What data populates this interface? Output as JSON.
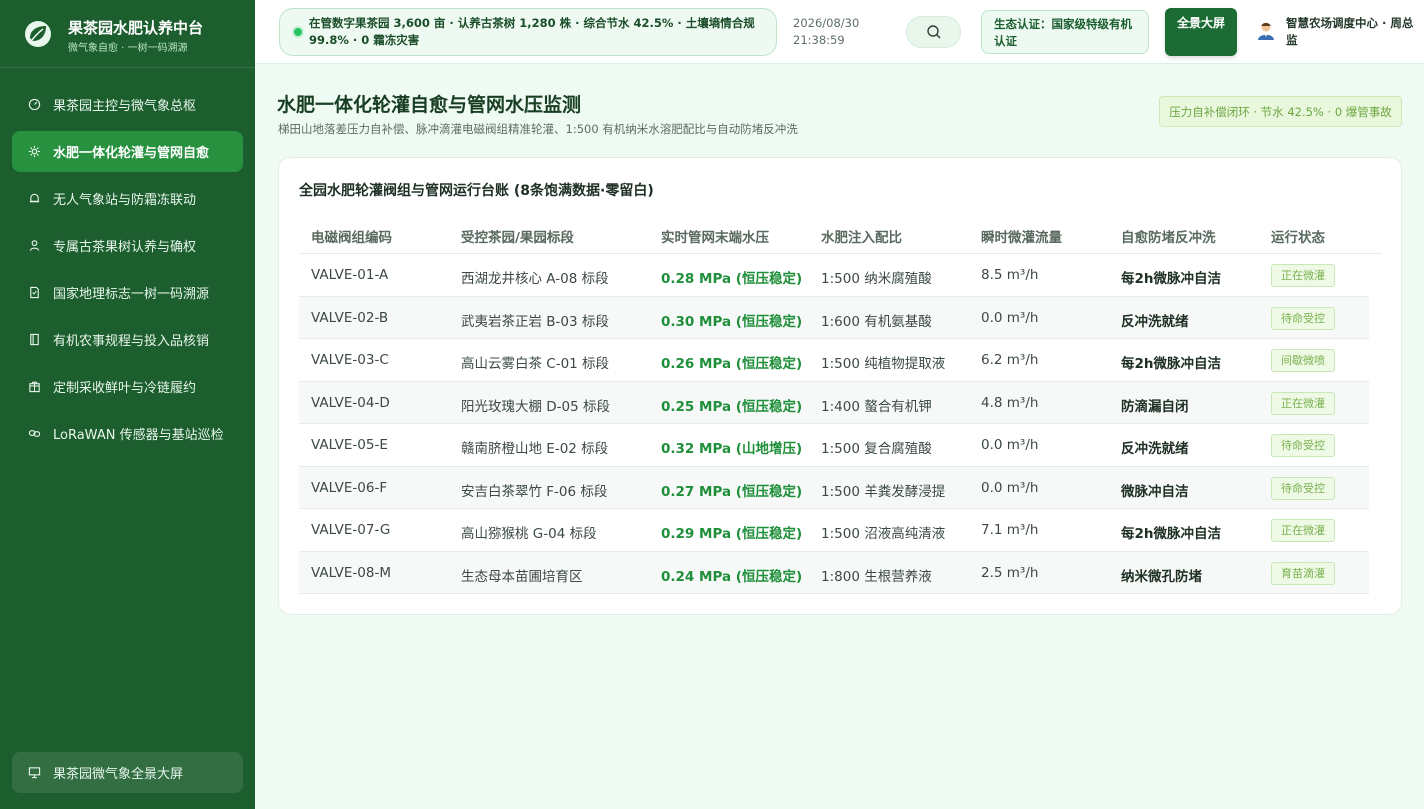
{
  "brand": {
    "title": "果茶园水肥认养中台",
    "subtitle": "微气象自愈 · 一树一码溯源",
    "logo_icon": "leaf-icon"
  },
  "sidebar": {
    "items": [
      {
        "label": "果茶园主控与微气象总枢",
        "icon": "dashboard-icon",
        "active": false
      },
      {
        "label": "水肥一体化轮灌与管网自愈",
        "icon": "gear-icon",
        "active": true
      },
      {
        "label": "无人气象站与防霜冻联动",
        "icon": "bell-icon",
        "active": false
      },
      {
        "label": "专属古茶果树认养与确权",
        "icon": "user-icon",
        "active": false
      },
      {
        "label": "国家地理标志一树一码溯源",
        "icon": "document-icon",
        "active": false
      },
      {
        "label": "有机农事规程与投入品核销",
        "icon": "book-icon",
        "active": false
      },
      {
        "label": "定制采收鲜叶与冷链履约",
        "icon": "package-icon",
        "active": false
      },
      {
        "label": "LoRaWAN 传感器与基站巡检",
        "icon": "link-icon",
        "active": false
      }
    ],
    "bottom": {
      "label": "果茶园微气象全景大屏",
      "icon": "monitor-icon"
    }
  },
  "header": {
    "ticker": "在管数字果茶园 3,600 亩 · 认养古茶树 1,280 株 · 综合节水 42.5% · 土壤墒情合规 99.8% · 0 霜冻灾害",
    "date": "2026/08/30",
    "time": "21:38:59",
    "search_icon": "search-icon",
    "cert": "生态认证：国家级特级有机认证",
    "bigscreen_label": "全景大屏",
    "user_name": "智慧农场调度中心 · 周总监"
  },
  "page": {
    "title": "水肥一体化轮灌自愈与管网水压监测",
    "subtitle": "梯田山地落差压力自补偿、脉冲滴灌电磁阀组精准轮灌、1:500 有机纳米水溶肥配比与自动防堵反冲洗",
    "status": "压力自补偿闭环 · 节水 42.5% · 0 爆管事故"
  },
  "table": {
    "title": "全园水肥轮灌阀组与管网运行台账 (8条饱满数据·零留白)",
    "columns": [
      "电磁阀组编码",
      "受控茶园/果园标段",
      "实时管网末端水压",
      "水肥注入配比",
      "瞬时微灌流量",
      "自愈防堵反冲洗",
      "运行状态"
    ],
    "rows": [
      {
        "code": "VALVE-01-A",
        "section": "西湖龙井核心 A-08 标段",
        "pressure": "0.28 MPa (恒压稳定)",
        "ratio": "1:500 纳米腐殖酸",
        "flow": "8.5 m³/h",
        "flush": "每2h微脉冲自洁",
        "status": "正在微灌"
      },
      {
        "code": "VALVE-02-B",
        "section": "武夷岩茶正岩 B-03 标段",
        "pressure": "0.30 MPa (恒压稳定)",
        "ratio": "1:600 有机氨基酸",
        "flow": "0.0 m³/h",
        "flush": "反冲洗就绪",
        "status": "待命受控"
      },
      {
        "code": "VALVE-03-C",
        "section": "高山云雾白茶 C-01 标段",
        "pressure": "0.26 MPa (恒压稳定)",
        "ratio": "1:500 纯植物提取液",
        "flow": "6.2 m³/h",
        "flush": "每2h微脉冲自洁",
        "status": "间歇微喷"
      },
      {
        "code": "VALVE-04-D",
        "section": "阳光玫瑰大棚 D-05 标段",
        "pressure": "0.25 MPa (恒压稳定)",
        "ratio": "1:400 螯合有机钾",
        "flow": "4.8 m³/h",
        "flush": "防滴漏自闭",
        "status": "正在微灌"
      },
      {
        "code": "VALVE-05-E",
        "section": "赣南脐橙山地 E-02 标段",
        "pressure": "0.32 MPa (山地增压)",
        "ratio": "1:500 复合腐殖酸",
        "flow": "0.0 m³/h",
        "flush": "反冲洗就绪",
        "status": "待命受控"
      },
      {
        "code": "VALVE-06-F",
        "section": "安吉白茶翠竹 F-06 标段",
        "pressure": "0.27 MPa (恒压稳定)",
        "ratio": "1:500 羊粪发酵浸提",
        "flow": "0.0 m³/h",
        "flush": "微脉冲自洁",
        "status": "待命受控"
      },
      {
        "code": "VALVE-07-G",
        "section": "高山猕猴桃 G-04 标段",
        "pressure": "0.29 MPa (恒压稳定)",
        "ratio": "1:500 沼液高纯清液",
        "flow": "7.1 m³/h",
        "flush": "每2h微脉冲自洁",
        "status": "正在微灌"
      },
      {
        "code": "VALVE-08-M",
        "section": "生态母本苗圃培育区",
        "pressure": "0.24 MPa (恒压稳定)",
        "ratio": "1:800 生根营养液",
        "flow": "2.5 m³/h",
        "flush": "纳米微孔防堵",
        "status": "育苗滴灌"
      }
    ]
  },
  "colors": {
    "sidebar": "#1c5e2e",
    "active": "#27913f",
    "accent": "#1f8f3a",
    "badge": "#78b04d",
    "background": "#effaf2"
  }
}
